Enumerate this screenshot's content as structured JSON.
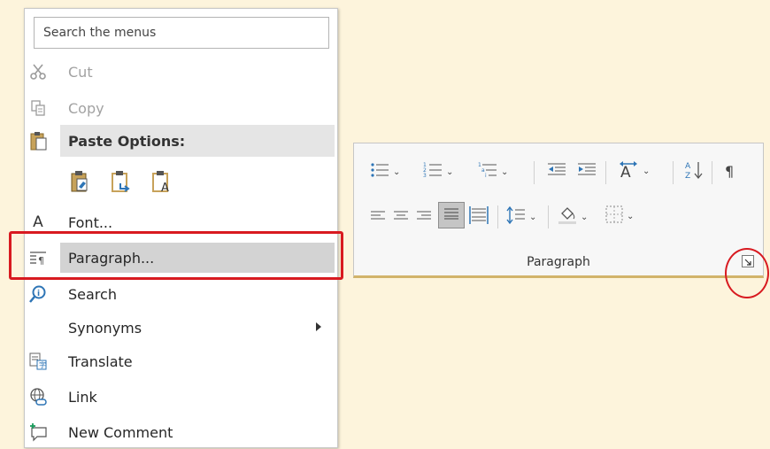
{
  "context_menu": {
    "search_placeholder": "Search the menus",
    "items": [
      {
        "label": "Cut",
        "icon": "scissors-icon",
        "disabled": true
      },
      {
        "label": "Copy",
        "icon": "copy-icon",
        "disabled": true
      },
      {
        "label": "Paste Options:",
        "icon": "clipboard-icon"
      },
      {
        "label": "Font...",
        "icon": "font-a-icon"
      },
      {
        "label": "Paragraph...",
        "icon": "paragraph-icon"
      },
      {
        "label": "Search",
        "icon": "search-icon"
      },
      {
        "label": "Synonyms",
        "icon": ""
      },
      {
        "label": "Translate",
        "icon": "translate-icon"
      },
      {
        "label": "Link",
        "icon": "link-icon"
      },
      {
        "label": "New Comment",
        "icon": "comment-icon"
      }
    ],
    "paste_option_icons": [
      "keep-source-formatting-icon",
      "merge-formatting-icon",
      "keep-text-only-icon"
    ]
  },
  "ribbon": {
    "group_label": "Paragraph",
    "row1_icons": [
      "bullets-icon",
      "numbering-icon",
      "multilevel-list-icon",
      "decrease-indent-icon",
      "increase-indent-icon",
      "text-direction-icon",
      "sort-icon",
      "show-formatting-marks-icon"
    ],
    "row2_icons": [
      "align-left-icon",
      "center-icon",
      "align-right-icon",
      "justify-icon",
      "distributed-icon",
      "line-spacing-icon",
      "shading-icon",
      "borders-icon"
    ],
    "launcher_icon": "dialog-launcher-icon"
  },
  "colors": {
    "highlight": "#d81a20",
    "background": "#fdf4dc",
    "ribbon_accent": "#d2b46a",
    "icon_blue": "#2e75b6"
  }
}
